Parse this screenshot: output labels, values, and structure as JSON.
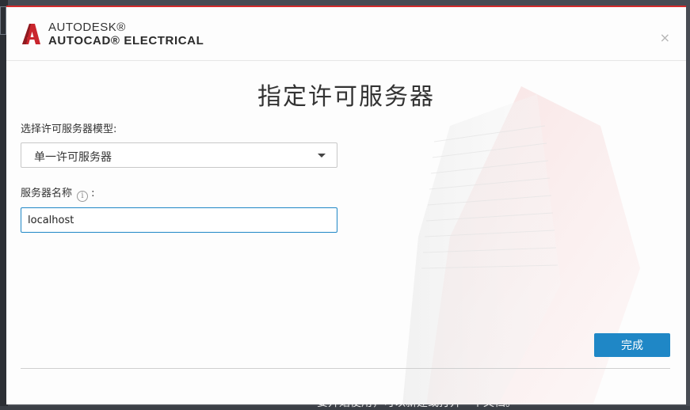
{
  "background": {
    "partial_text": "要开始使用，可以新建或打开一个文档。"
  },
  "dialog": {
    "brand": {
      "company": "AUTODESK®",
      "product": "AUTOCAD® ELECTRICAL"
    },
    "close_label": "×",
    "title": "指定许可服务器",
    "model_label": "选择许可服务器模型:",
    "model_select": {
      "selected": "单一许可服务器"
    },
    "server_name_label": "服务器名称",
    "server_name_colon": ":",
    "info_glyph": "i",
    "server_name_input": {
      "value": "localhost"
    },
    "finish_label": "完成"
  },
  "colors": {
    "accent": "#1f87c6",
    "brand_red": "#d42b2b"
  },
  "icons": [
    "autocad-logo-icon",
    "close-icon",
    "info-icon",
    "chevron-down-icon"
  ]
}
